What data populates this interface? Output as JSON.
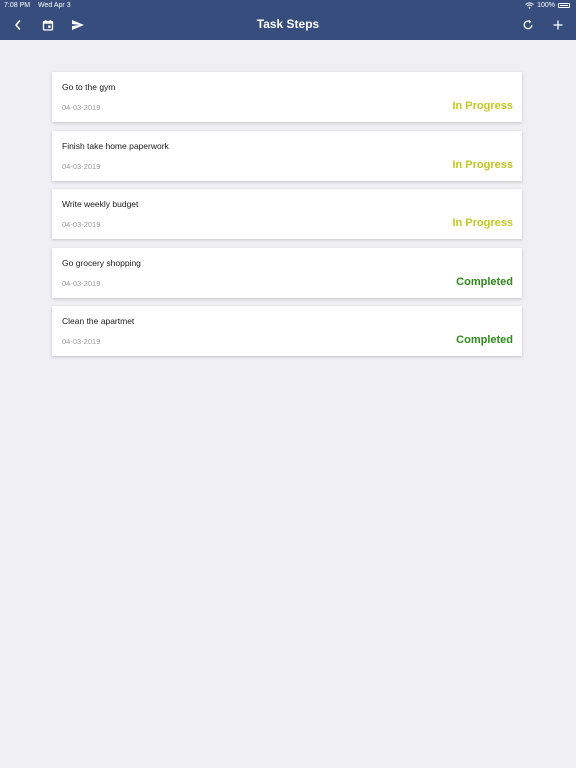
{
  "status_bar": {
    "time": "7:08 PM",
    "date": "Wed Apr 3",
    "battery": "100%"
  },
  "nav": {
    "title": "Task Steps",
    "icons": [
      "chevron-left-icon",
      "calendar-icon",
      "send-icon",
      "refresh-icon",
      "plus-icon"
    ]
  },
  "colors": {
    "header_bg": "#364d7d",
    "page_bg": "#efeff4",
    "in_progress": "#c2c824",
    "completed": "#2f8a1c"
  },
  "tasks": [
    {
      "title": "Go to the gym",
      "date": "04-03-2019",
      "status": "In Progress",
      "state": "in_progress"
    },
    {
      "title": "Finish take home paperwork",
      "date": "04-03-2019",
      "status": "In Progress",
      "state": "in_progress"
    },
    {
      "title": "Write weekly budget",
      "date": "04-03-2019",
      "status": "In Progress",
      "state": "in_progress"
    },
    {
      "title": "Go grocery shopping",
      "date": "04-03-2019",
      "status": "Completed",
      "state": "completed"
    },
    {
      "title": "Clean the apartmet",
      "date": "04-03-2019",
      "status": "Completed",
      "state": "completed"
    }
  ]
}
